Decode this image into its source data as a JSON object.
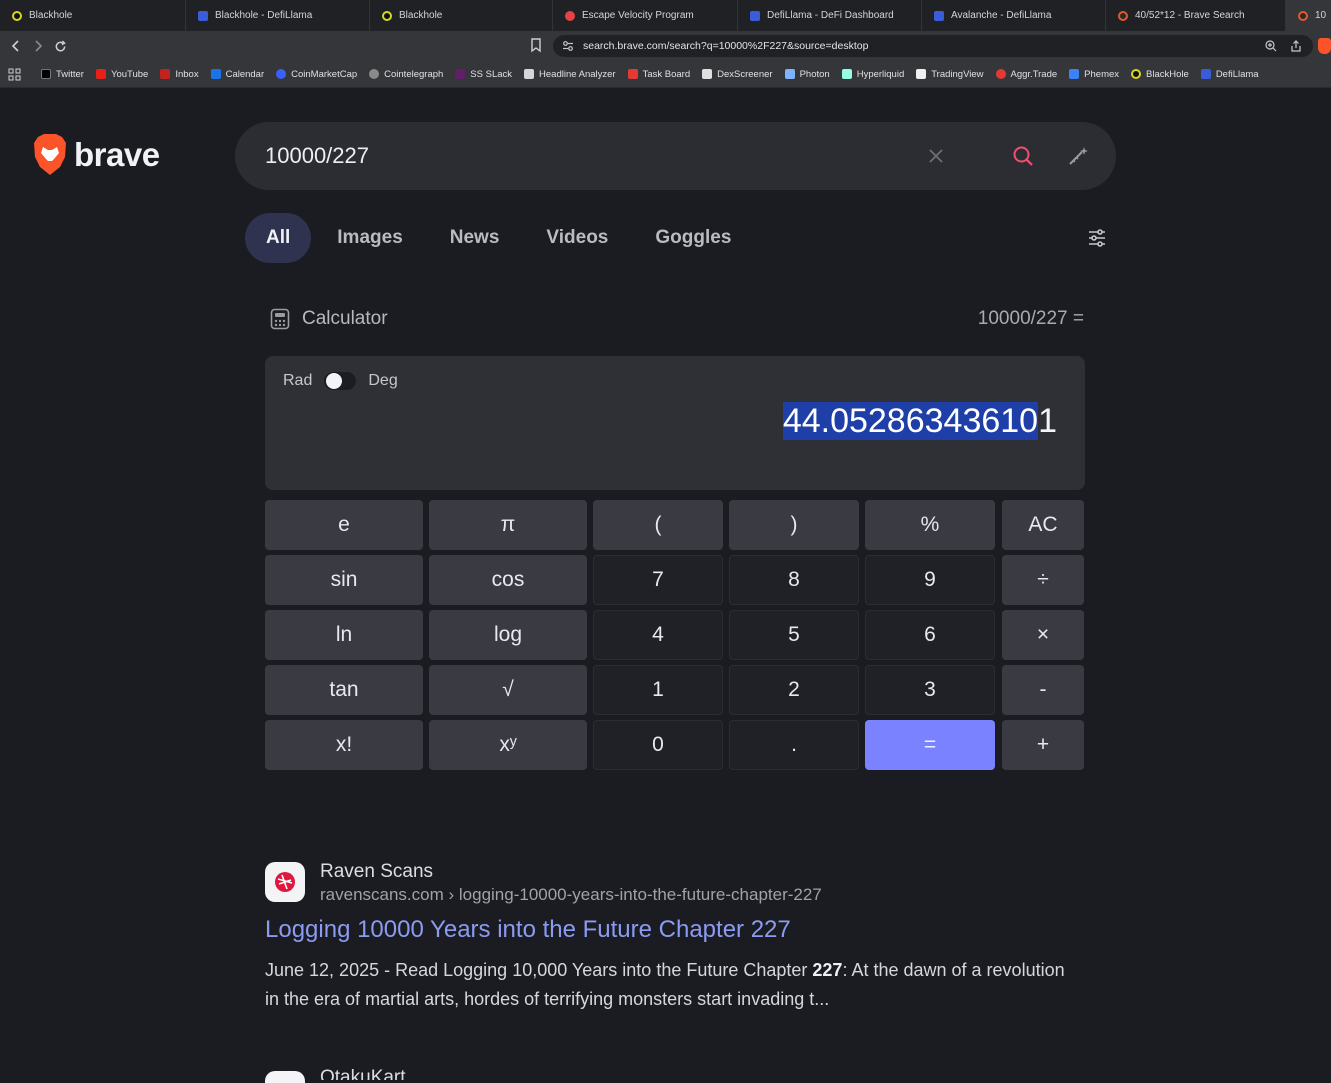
{
  "browser": {
    "tabs": [
      {
        "title": "Blackhole",
        "icon": "blackhole-icon",
        "color": "#2b2b2b"
      },
      {
        "title": "Blackhole - DefiLlama",
        "icon": "defillama-icon",
        "color": "#3b5bdb"
      },
      {
        "title": "Blackhole",
        "icon": "blackhole-icon",
        "color": "#2b2b2b"
      },
      {
        "title": "Escape Velocity Program",
        "icon": "avalanche-icon",
        "color": "#e84142"
      },
      {
        "title": "DefiLlama - DeFi Dashboard",
        "icon": "defillama-icon",
        "color": "#3b5bdb"
      },
      {
        "title": "Avalanche - DefiLlama",
        "icon": "defillama-icon",
        "color": "#3b5bdb"
      },
      {
        "title": "40/52*12 - Brave Search",
        "icon": "brave-search-icon",
        "color": "#e25a2c"
      },
      {
        "title": "10",
        "icon": "brave-search-icon",
        "color": "#e25a2c"
      }
    ],
    "url": "search.brave.com/search?q=10000%2F227&source=desktop",
    "bookmarks": [
      {
        "label": "Twitter",
        "color": "#000000"
      },
      {
        "label": "YouTube",
        "color": "#e62117"
      },
      {
        "label": "Inbox",
        "color": "#c5221f"
      },
      {
        "label": "Calendar",
        "color": "#1a73e8"
      },
      {
        "label": "CoinMarketCap",
        "color": "#3861fb"
      },
      {
        "label": "Cointelegraph",
        "color": "#8a8a8a"
      },
      {
        "label": "SS SLack",
        "color": "#611f69"
      },
      {
        "label": "Headline Analyzer",
        "color": "#5a5a5a"
      },
      {
        "label": "Task Board",
        "color": "#e53935"
      },
      {
        "label": "DexScreener",
        "color": "#e0e0e0"
      },
      {
        "label": "Photon",
        "color": "#7fb3ff"
      },
      {
        "label": "Hyperliquid",
        "color": "#97fce4"
      },
      {
        "label": "TradingView",
        "color": "#131722"
      },
      {
        "label": "Aggr.Trade",
        "color": "#e53935"
      },
      {
        "label": "Phemex",
        "color": "#3b82f6"
      },
      {
        "label": "BlackHole",
        "color": "#2b2b2b"
      },
      {
        "label": "DefiLlama",
        "color": "#3b5bdb"
      }
    ]
  },
  "brand": {
    "word": "brave"
  },
  "search": {
    "query": "10000/227"
  },
  "nav_tabs": [
    "All",
    "Images",
    "News",
    "Videos",
    "Goggles"
  ],
  "calculator": {
    "title": "Calculator",
    "expression": "10000/227 =",
    "mode_rad": "Rad",
    "mode_deg": "Deg",
    "result_selected": "44.05286343610",
    "result_rest": "1",
    "keys": [
      [
        "e",
        "π",
        "(",
        ")",
        "%",
        "AC"
      ],
      [
        "sin",
        "cos",
        "7",
        "8",
        "9",
        "÷"
      ],
      [
        "ln",
        "log",
        "4",
        "5",
        "6",
        "×"
      ],
      [
        "tan",
        "√",
        "1",
        "2",
        "3",
        "-"
      ],
      [
        "x!",
        "xʸ",
        "0",
        ".",
        "=",
        "+"
      ]
    ]
  },
  "results": [
    {
      "site_name": "Raven Scans",
      "site_url": "ravenscans.com › logging-10000-years-into-the-future-chapter-227",
      "title": "Logging 10000 Years into the Future Chapter 227",
      "desc_before": "June 12, 2025 - Read Logging 10,000 Years into the Future Chapter ",
      "desc_bold": "227",
      "desc_after": ": At the dawn of a revolution in the era of martial arts, hordes of terrifying monsters start invading t..."
    },
    {
      "site_name": "OtakuKart"
    }
  ],
  "colors": {
    "accent": "#7b82ff",
    "link": "#8b9bf2",
    "selection": "#1f3fa8",
    "brave_orange": "#fb542b"
  }
}
